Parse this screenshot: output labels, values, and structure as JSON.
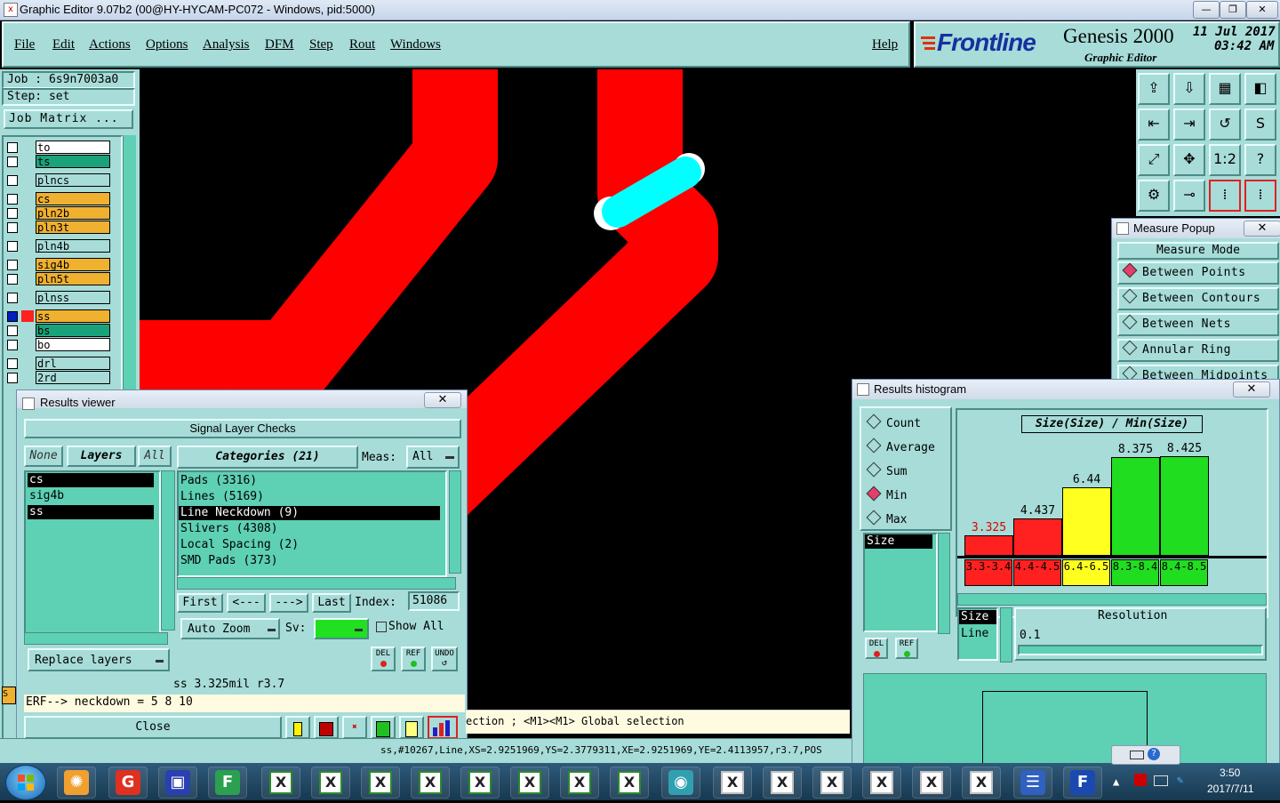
{
  "window": {
    "title": "Graphic Editor 9.07b2 (00@HY-HYCAM-PC072 - Windows, pid:5000)"
  },
  "menu": {
    "file": "File",
    "edit": "Edit",
    "actions": "Actions",
    "options": "Options",
    "analysis": "Analysis",
    "dfm": "DFM",
    "step": "Step",
    "rout": "Rout",
    "windows": "Windows",
    "help": "Help"
  },
  "brand": {
    "logo": "Frontline",
    "product": "Genesis 2000",
    "subtitle": "Graphic Editor",
    "date": "11 Jul 2017",
    "time": "03:42 AM"
  },
  "job": {
    "job_label": "Job : 6s9n7003a0",
    "step_label": "Step: set",
    "matrix_button": "Job Matrix ..."
  },
  "layers": [
    {
      "name": "to",
      "color": "#ffffff"
    },
    {
      "name": "ts",
      "color": "#1aa37a"
    },
    {
      "name": "plncs",
      "color": "#a7dcd8"
    },
    {
      "name": "cs",
      "color": "#f0b030"
    },
    {
      "name": "pln2b",
      "color": "#f0b030"
    },
    {
      "name": "pln3t",
      "color": "#f0b030"
    },
    {
      "name": "pln4b",
      "color": "#a7dcd8"
    },
    {
      "name": "sig4b",
      "color": "#f0b030"
    },
    {
      "name": "pln5t",
      "color": "#f0b030"
    },
    {
      "name": "plnss",
      "color": "#a7dcd8"
    },
    {
      "name": "ss",
      "color": "#f0b030"
    },
    {
      "name": "bs",
      "color": "#1aa37a"
    },
    {
      "name": "bo",
      "color": "#ffffff"
    },
    {
      "name": "drl",
      "color": "#a7dcd8"
    },
    {
      "name": "2rd",
      "color": "#a7dcd8"
    }
  ],
  "measure_popup": {
    "title": "Measure Popup",
    "header": "Measure Mode",
    "options": [
      "Between Points",
      "Between Contours",
      "Between Nets",
      "Annular Ring",
      "Between Midpoints"
    ],
    "selected": "Between Points"
  },
  "results_viewer": {
    "title": "Results viewer",
    "heading": "Signal Layer Checks",
    "none_btn": "None",
    "layers_btn": "Layers",
    "all_btn": "All",
    "categories_btn": "Categories (21)",
    "meas_label": "Meas:",
    "meas_value": "All",
    "layer_list": [
      "cs",
      "sig4b",
      "ss"
    ],
    "category_list": [
      "Pads (3316)",
      "Lines (5169)",
      "Line Neckdown (9)",
      "Slivers (4308)",
      "Local Spacing (2)",
      "SMD Pads (373)"
    ],
    "selected_category": "Line Neckdown (9)",
    "first_btn": "First",
    "prev_btn": "<---",
    "next_btn": "--->",
    "last_btn": "Last",
    "index_label": "Index:",
    "index_value": "51086",
    "auto_zoom": "Auto Zoom",
    "sv_label": "Sv:",
    "show_all": "Show All",
    "replace_layers": "Replace layers",
    "del": "DEL",
    "ref": "REF",
    "undo": "UNDO",
    "status": "ss 3.325mil  r3.7",
    "erf": "ERF--> neckdown = 5 8 10",
    "close": "Close"
  },
  "histogram": {
    "title": "Results histogram",
    "options": [
      "Count",
      "Average",
      "Sum",
      "Min",
      "Max"
    ],
    "selected": "Min",
    "chart_title": "Size(Size) / Min(Size)",
    "size_item": "Size",
    "line_item": "Line",
    "resolution_label": "Resolution",
    "resolution_value": "0.1",
    "del": "DEL",
    "ref": "REF"
  },
  "chart_data": {
    "type": "bar",
    "title": "Size(Size) / Min(Size)",
    "categories": [
      "3.3-3.4",
      "4.4-4.5",
      "6.4-6.5",
      "8.3-8.4",
      "8.4-8.5"
    ],
    "values": [
      3.325,
      4.437,
      6.44,
      8.375,
      8.425
    ],
    "value_labels": [
      "3.325",
      "4.437",
      "6.44",
      "8.375",
      "8.425"
    ],
    "bar_colors": [
      "#ff2020",
      "#ff2020",
      "#ffff20",
      "#20dd20",
      "#20dd20"
    ],
    "ylim": [
      0,
      9
    ]
  },
  "status_bar": {
    "hint": "ection ; <M1><M1> Global selection",
    "coords": "ss,#10267,Line,XS=2.9251969,YS=2.3779311,XE=2.9251969,YE=2.4113957,r3.7,POS"
  },
  "taskbar": {
    "time": "3:50",
    "date": "2017/7/11"
  }
}
